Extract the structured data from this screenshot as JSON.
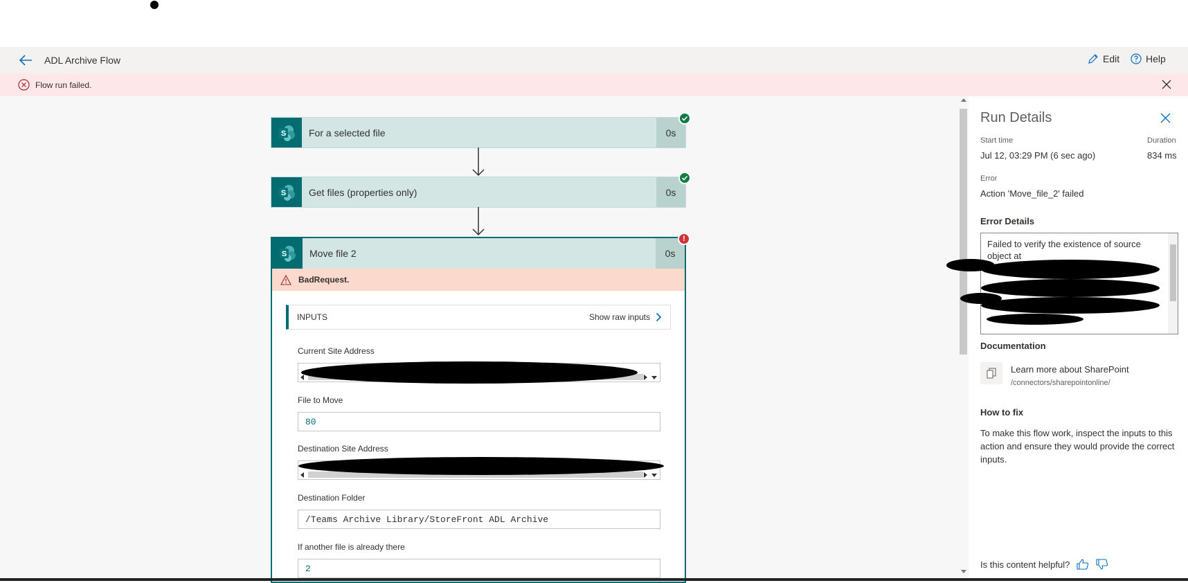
{
  "header": {
    "title": "ADL Archive Flow",
    "edit_label": "Edit",
    "help_label": "Help"
  },
  "error_banner": {
    "message": "Flow run failed."
  },
  "flow": {
    "steps": [
      {
        "name": "For a selected file",
        "duration": "0s",
        "status": "success"
      },
      {
        "name": "Get files (properties only)",
        "duration": "0s",
        "status": "success"
      },
      {
        "name": "Move file 2",
        "duration": "0s",
        "status": "failed"
      }
    ],
    "expanded": {
      "error_label": "BadRequest.",
      "inputs_label": "INPUTS",
      "show_raw_label": "Show raw inputs",
      "fields": [
        {
          "label": "Current Site Address",
          "value": ""
        },
        {
          "label": "File to Move",
          "value": "80"
        },
        {
          "label": "Destination Site Address",
          "value": ""
        },
        {
          "label": "Destination Folder",
          "value": "/Teams Archive Library/StoreFront ADL Archive"
        },
        {
          "label": "If another file is already there",
          "value": "2"
        }
      ]
    }
  },
  "run_details": {
    "title": "Run Details",
    "start_time_label": "Start time",
    "start_time_value": "Jul 12, 03:29 PM (6 sec ago)",
    "duration_label": "Duration",
    "duration_value": "834 ms",
    "error_label": "Error",
    "error_value": "Action 'Move_file_2' failed",
    "error_details_label": "Error Details",
    "error_details_text": "Failed to verify the existence of source object at",
    "documentation_label": "Documentation",
    "doc_link": "Learn more about SharePoint",
    "doc_path": "/connectors/sharepointonline/",
    "how_to_fix_label": "How to fix",
    "how_to_fix_text": "To make this flow work, inspect the inputs to this action and ensure they would provide the correct inputs.",
    "helpful_question": "Is this content helpful?"
  },
  "colors": {
    "accent": "#036c70",
    "card_bg": "#d3e6e3",
    "error_banner_bg": "#fde7e9",
    "bad_request_bg": "#fcd9cd",
    "success": "#107c41",
    "failure": "#d13438"
  }
}
